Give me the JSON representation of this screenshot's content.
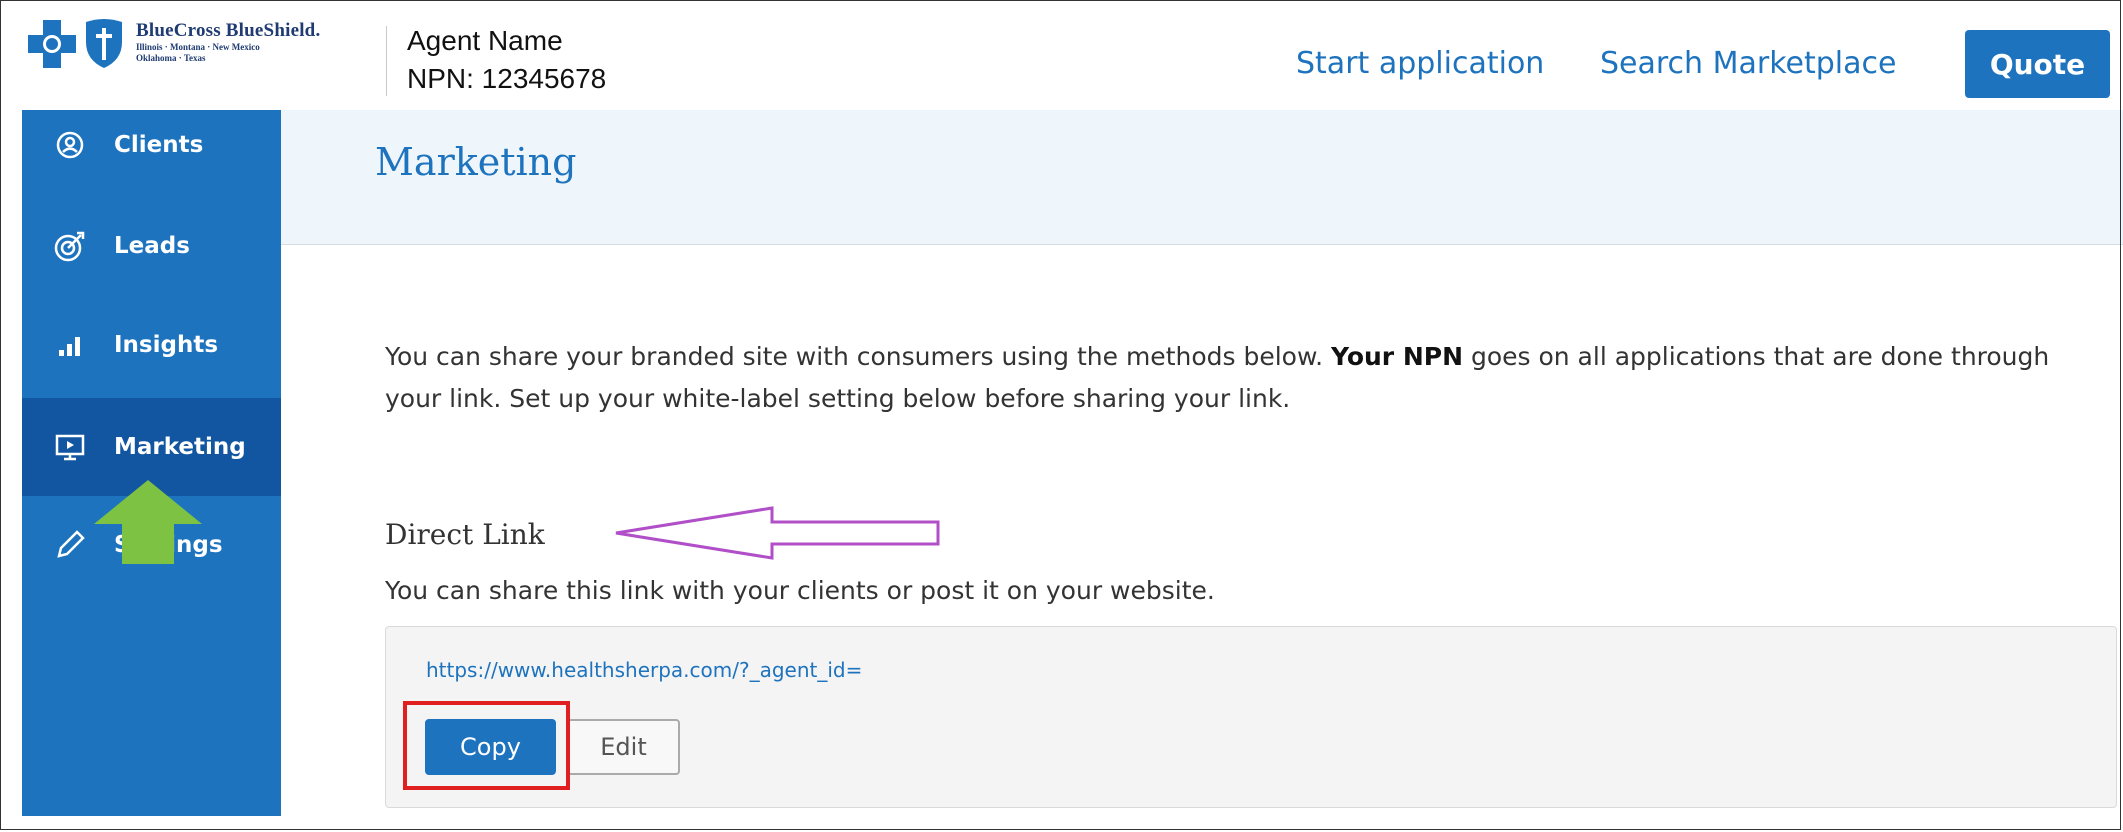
{
  "header": {
    "logo": {
      "title": "BlueCross BlueShield.",
      "subtitle_line1": "Illinois · Montana · New Mexico",
      "subtitle_line2": "Oklahoma · Texas"
    },
    "agent_name": "Agent Name",
    "agent_npn": "NPN: 12345678",
    "nav": {
      "start_application": "Start application",
      "search_marketplace": "Search Marketplace",
      "quote": "Quote"
    }
  },
  "sidebar": {
    "items": [
      {
        "label": "Clients",
        "icon": "user-circle-icon"
      },
      {
        "label": "Leads",
        "icon": "target-icon"
      },
      {
        "label": "Insights",
        "icon": "bar-chart-icon"
      },
      {
        "label": "Marketing",
        "icon": "monitor-icon",
        "active": true
      },
      {
        "label": "Settings",
        "icon": "pencil-icon"
      }
    ]
  },
  "main": {
    "title": "Marketing",
    "intro_part1": "You can share your branded site with consumers using the methods below. ",
    "intro_bold": "Your NPN",
    "intro_part2": " goes on all applications that are done through your link. Set up your white-label setting below before sharing your link.",
    "direct_link": {
      "title": "Direct Link",
      "subtitle": "You can share this link with your clients or post it on your website.",
      "url": "https://www.healthsherpa.com/?_agent_id=",
      "copy_label": "Copy",
      "edit_label": "Edit"
    }
  },
  "colors": {
    "brand_blue": "#1e73be",
    "sidebar_active": "#1255a0",
    "annotation_green": "#7dc242",
    "annotation_purple": "#b04fc8",
    "annotation_red": "#e02020"
  }
}
